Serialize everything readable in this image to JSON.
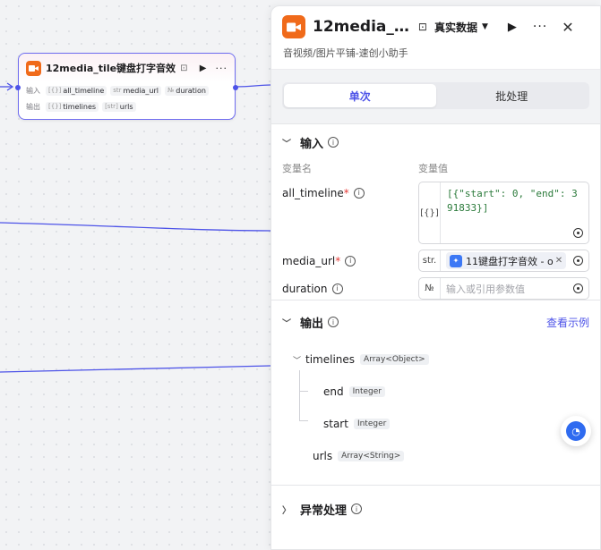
{
  "node": {
    "title": "12media_tile键盘打字音效",
    "input_label": "输入",
    "output_label": "输出",
    "inputs": [
      {
        "type": "[{}]",
        "name": "all_timeline"
      },
      {
        "type": "str",
        "name": "media_url"
      },
      {
        "type": "№",
        "name": "duration"
      }
    ],
    "outputs": [
      {
        "type": "[{}]",
        "name": "timelines"
      },
      {
        "type": "[str]",
        "name": "urls"
      }
    ]
  },
  "panel": {
    "title": "12media_…",
    "mode": "真实数据",
    "description": "音视频/图片平铺-速创小助手",
    "tabs": [
      "单次",
      "批处理"
    ],
    "input_section": {
      "title": "输入",
      "col_name": "变量名",
      "col_value": "变量值",
      "vars": [
        {
          "name": "all_timeline",
          "type_tag": "[{}]",
          "value": "[{\"start\": 0, \"end\": 391833}]"
        },
        {
          "name": "media_url",
          "type_tag": "str.",
          "ref_value": "11键盘打字音效 - o"
        },
        {
          "name": "duration",
          "type_tag": "№",
          "placeholder": "输入或引用参数值"
        }
      ]
    },
    "output_section": {
      "title": "输出",
      "link": "查看示例",
      "items": [
        {
          "name": "timelines",
          "type": "Array<Object>"
        },
        {
          "name": "end",
          "type": "Integer"
        },
        {
          "name": "start",
          "type": "Integer"
        },
        {
          "name": "urls",
          "type": "Array<String>"
        }
      ]
    },
    "exception_section": {
      "title": "异常处理"
    }
  },
  "colors": {
    "accent": "#4d53e8",
    "logo": "#f06a1a",
    "link": "#4d53e8",
    "fab": "#2f6bf0"
  },
  "icons": [
    "video-logo-icon",
    "test-run-icon",
    "more-icon",
    "close-icon",
    "info-icon",
    "chevron-down-icon",
    "target-icon",
    "chat-icon"
  ]
}
